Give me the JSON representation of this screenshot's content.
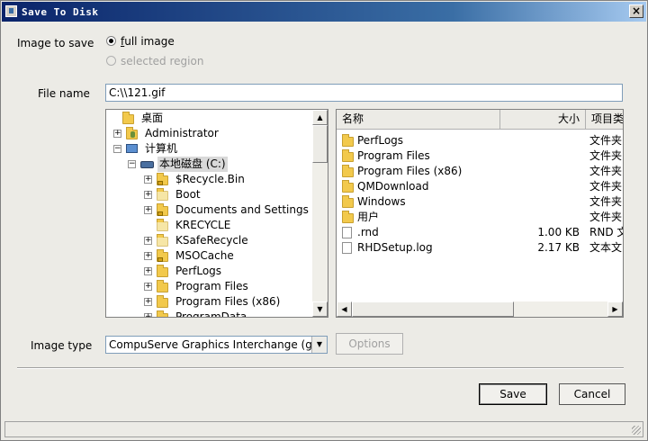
{
  "window": {
    "title": "Save To Disk",
    "close_glyph": "×"
  },
  "image_to_save": {
    "label": "Image to save",
    "options": [
      {
        "label": "full image",
        "checked": true,
        "enabled": true
      },
      {
        "label": "selected region",
        "checked": false,
        "enabled": false
      }
    ]
  },
  "file_name": {
    "label": "File name",
    "value": "C:\\\\121.gif"
  },
  "tree": {
    "items": [
      {
        "label": "桌面",
        "icon": "folder-icon",
        "expander": ""
      },
      {
        "label": "Administrator",
        "icon": "user-folder-icon",
        "expander": "+"
      },
      {
        "label": "计算机",
        "icon": "computer-icon",
        "expander": "−"
      },
      {
        "label": "本地磁盘 (C:)",
        "icon": "drive-icon",
        "expander": "−",
        "selected": true
      },
      {
        "label": "$Recycle.Bin",
        "icon": "locked-folder-icon",
        "expander": "+"
      },
      {
        "label": "Boot",
        "icon": "folder-icon",
        "expander": "+"
      },
      {
        "label": "Documents and Settings",
        "icon": "locked-folder-icon",
        "expander": "+"
      },
      {
        "label": "KRECYCLE",
        "icon": "folder-icon",
        "expander": ""
      },
      {
        "label": "KSafeRecycle",
        "icon": "folder-icon",
        "expander": "+"
      },
      {
        "label": "MSOCache",
        "icon": "locked-folder-icon",
        "expander": "+"
      },
      {
        "label": "PerfLogs",
        "icon": "folder-icon",
        "expander": "+"
      },
      {
        "label": "Program Files",
        "icon": "folder-icon",
        "expander": "+"
      },
      {
        "label": "Program Files (x86)",
        "icon": "folder-icon",
        "expander": "+"
      },
      {
        "label": "ProgramData",
        "icon": "folder-icon",
        "expander": "+"
      }
    ]
  },
  "file_list": {
    "columns": [
      "名称",
      "大小",
      "项目类"
    ],
    "rows": [
      {
        "name": "PerfLogs",
        "size": "",
        "type": "文件夹",
        "icon": "folder-icon"
      },
      {
        "name": "Program Files",
        "size": "",
        "type": "文件夹",
        "icon": "folder-icon"
      },
      {
        "name": "Program Files (x86)",
        "size": "",
        "type": "文件夹",
        "icon": "folder-icon"
      },
      {
        "name": "QMDownload",
        "size": "",
        "type": "文件夹",
        "icon": "folder-icon"
      },
      {
        "name": "Windows",
        "size": "",
        "type": "文件夹",
        "icon": "folder-icon"
      },
      {
        "name": "用户",
        "size": "",
        "type": "文件夹",
        "icon": "folder-icon"
      },
      {
        "name": ".rnd",
        "size": "1.00 KB",
        "type": "RND 文",
        "icon": "file-icon"
      },
      {
        "name": "RHDSetup.log",
        "size": "2.17 KB",
        "type": "文本文",
        "icon": "file-icon"
      }
    ]
  },
  "image_type": {
    "label": "Image type",
    "value": "CompuServe Graphics Interchange (gif)"
  },
  "buttons": {
    "options": "Options",
    "save": "Save",
    "cancel": "Cancel"
  },
  "colors": {
    "titlebar": "#0a246a",
    "folder": "#f2c94c",
    "selection": "#d9d9d9"
  }
}
